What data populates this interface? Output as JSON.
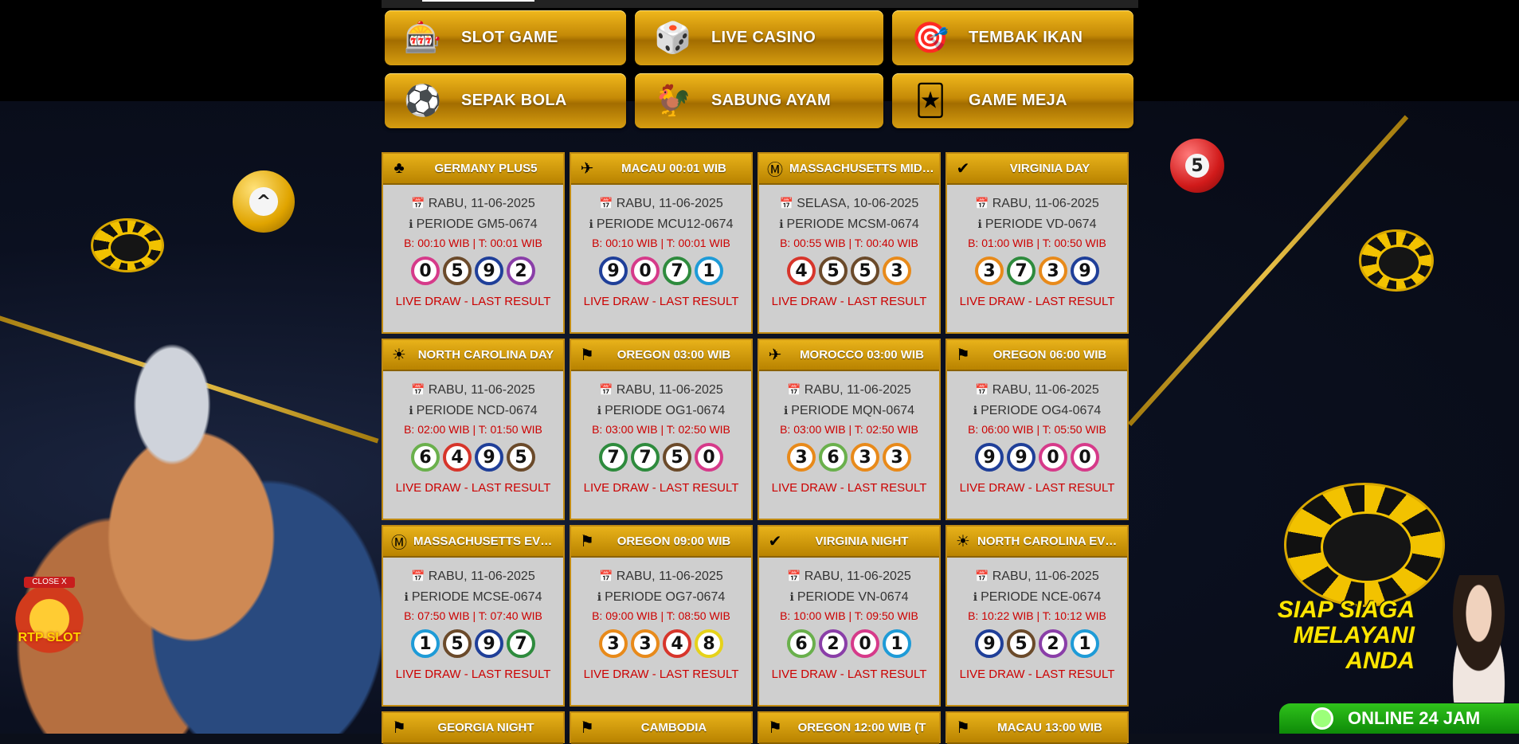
{
  "menu": [
    {
      "label": "SLOT GAME",
      "icon": "slot-machine-icon"
    },
    {
      "label": "LIVE CASINO",
      "icon": "live-casino-icon"
    },
    {
      "label": "TEMBAK IKAN",
      "icon": "fish-shooting-icon"
    },
    {
      "label": "SEPAK BOLA",
      "icon": "soccer-icon"
    },
    {
      "label": "SABUNG AYAM",
      "icon": "rooster-icon"
    },
    {
      "label": "GAME MEJA",
      "icon": "table-game-icon"
    }
  ],
  "draw_link": "LIVE DRAW - LAST RESULT",
  "markets": [
    {
      "title": "GERMANY PLUS5",
      "flag": "clover-icon",
      "date": "RABU, 11-06-2025",
      "periode": "PERIODE GM5-0674",
      "time": "B: 00:10 WIB | T: 00:01 WIB",
      "numbers": [
        "0",
        "5",
        "9",
        "2"
      ],
      "colors": [
        "#d63a8a",
        "#6b4a2a",
        "#1f3f99",
        "#8a3ea8"
      ]
    },
    {
      "title": "MACAU 00:01 WIB",
      "flag": "macau-flag-icon",
      "date": "RABU, 11-06-2025",
      "periode": "PERIODE MCU12-0674",
      "time": "B: 00:10 WIB | T: 00:01 WIB",
      "numbers": [
        "9",
        "0",
        "7",
        "1"
      ],
      "colors": [
        "#1f3f99",
        "#d63a8a",
        "#2e8b3d",
        "#1e9bd7"
      ]
    },
    {
      "title": "MASSACHUSETTS MIDDAY",
      "flag": "ma-badge-icon",
      "date": "SELASA, 10-06-2025",
      "periode": "PERIODE MCSM-0674",
      "time": "B: 00:55 WIB | T: 00:40 WIB",
      "numbers": [
        "4",
        "5",
        "5",
        "3"
      ],
      "colors": [
        "#d7352b",
        "#6b4a2a",
        "#6b4a2a",
        "#e88a1a"
      ]
    },
    {
      "title": "VIRGINIA DAY",
      "flag": "virginia-icon",
      "date": "RABU, 11-06-2025",
      "periode": "PERIODE VD-0674",
      "time": "B: 01:00 WIB | T: 00:50 WIB",
      "numbers": [
        "3",
        "7",
        "3",
        "9"
      ],
      "colors": [
        "#e88a1a",
        "#2e8b3d",
        "#e88a1a",
        "#1f3f99"
      ]
    },
    {
      "title": "NORTH CAROLINA DAY",
      "flag": "nc-sun-icon",
      "date": "RABU, 11-06-2025",
      "periode": "PERIODE NCD-0674",
      "time": "B: 02:00 WIB | T: 01:50 WIB",
      "numbers": [
        "6",
        "4",
        "9",
        "5"
      ],
      "colors": [
        "#6ab04c",
        "#d7352b",
        "#1f3f99",
        "#6b4a2a"
      ]
    },
    {
      "title": "OREGON 03:00 WIB",
      "flag": "oregon-icon",
      "date": "RABU, 11-06-2025",
      "periode": "PERIODE OG1-0674",
      "time": "B: 03:00 WIB | T: 02:50 WIB",
      "numbers": [
        "7",
        "7",
        "5",
        "0"
      ],
      "colors": [
        "#2e8b3d",
        "#2e8b3d",
        "#6b4a2a",
        "#d63a8a"
      ]
    },
    {
      "title": "MOROCCO 03:00 WIB",
      "flag": "morocco-icon",
      "date": "RABU, 11-06-2025",
      "periode": "PERIODE MQN-0674",
      "time": "B: 03:00 WIB | T: 02:50 WIB",
      "numbers": [
        "3",
        "6",
        "3",
        "3"
      ],
      "colors": [
        "#e88a1a",
        "#6ab04c",
        "#e88a1a",
        "#e88a1a"
      ]
    },
    {
      "title": "OREGON 06:00 WIB",
      "flag": "oregon-icon",
      "date": "RABU, 11-06-2025",
      "periode": "PERIODE OG4-0674",
      "time": "B: 06:00 WIB | T: 05:50 WIB",
      "numbers": [
        "9",
        "9",
        "0",
        "0"
      ],
      "colors": [
        "#1f3f99",
        "#1f3f99",
        "#d63a8a",
        "#d63a8a"
      ]
    },
    {
      "title": "MASSACHUSETTS EVENING",
      "flag": "ma-badge-icon",
      "date": "RABU, 11-06-2025",
      "periode": "PERIODE MCSE-0674",
      "time": "B: 07:50 WIB | T: 07:40 WIB",
      "numbers": [
        "1",
        "5",
        "9",
        "7"
      ],
      "colors": [
        "#1e9bd7",
        "#6b4a2a",
        "#1f3f99",
        "#2e8b3d"
      ]
    },
    {
      "title": "OREGON 09:00 WIB",
      "flag": "oregon-icon",
      "date": "RABU, 11-06-2025",
      "periode": "PERIODE OG7-0674",
      "time": "B: 09:00 WIB | T: 08:50 WIB",
      "numbers": [
        "3",
        "3",
        "4",
        "8"
      ],
      "colors": [
        "#e88a1a",
        "#e88a1a",
        "#d7352b",
        "#e6d21a"
      ]
    },
    {
      "title": "VIRGINIA NIGHT",
      "flag": "virginia-icon",
      "date": "RABU, 11-06-2025",
      "periode": "PERIODE VN-0674",
      "time": "B: 10:00 WIB | T: 09:50 WIB",
      "numbers": [
        "6",
        "2",
        "0",
        "1"
      ],
      "colors": [
        "#6ab04c",
        "#8a3ea8",
        "#d63a8a",
        "#1e9bd7"
      ]
    },
    {
      "title": "NORTH CAROLINA EVENING",
      "flag": "nc-sun-icon",
      "date": "RABU, 11-06-2025",
      "periode": "PERIODE NCE-0674",
      "time": "B: 10:22 WIB | T: 10:12 WIB",
      "numbers": [
        "9",
        "5",
        "2",
        "1"
      ],
      "colors": [
        "#1f3f99",
        "#6b4a2a",
        "#8a3ea8",
        "#1e9bd7"
      ]
    }
  ],
  "next_row": [
    "GEORGIA NIGHT",
    "CAMBODIA",
    "OREGON 12:00 WIB (T",
    "MACAU 13:00 WIB"
  ],
  "rtp_widget": {
    "close": "CLOSE X",
    "label": "RTP SLOT"
  },
  "promo": {
    "line1": "SIAP SIAGA",
    "line2": "MELAYANI",
    "line3": "ANDA"
  },
  "online_badge": "ONLINE 24 JAM",
  "decor_balls": [
    {
      "number": "^"
    },
    {
      "number": "5"
    }
  ]
}
